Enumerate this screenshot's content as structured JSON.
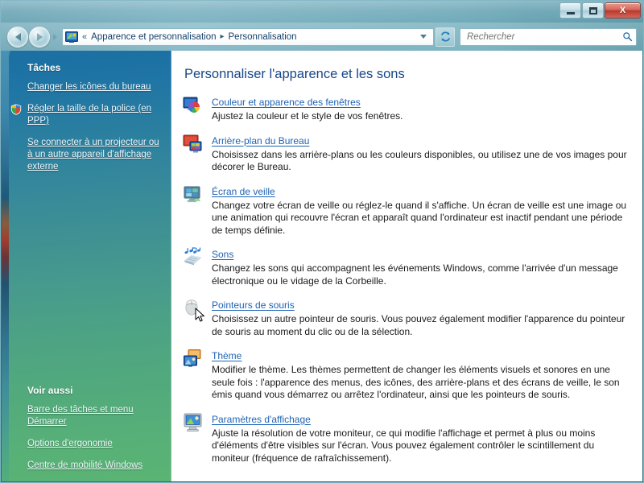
{
  "window": {
    "controls": {
      "minimize": "—",
      "maximize": "□",
      "close": "X"
    }
  },
  "toolbar": {
    "back_tooltip": "Précédent",
    "forward_tooltip": "Suivant",
    "breadcrumb_chevron": "«",
    "breadcrumb": [
      {
        "label": "Apparence et personnalisation"
      },
      {
        "label": "Personnalisation"
      }
    ],
    "breadcrumb_separator": "▸",
    "refresh_label": "↯",
    "search": {
      "placeholder": "Rechercher",
      "value": "",
      "icon": "search-icon"
    }
  },
  "sidebar": {
    "tasks_heading": "Tâches",
    "tasks": [
      {
        "label": "Changer les icônes du bureau",
        "shield": false
      },
      {
        "label": "Régler la taille de la police (en PPP)",
        "shield": true
      },
      {
        "label": "Se connecter à un projecteur ou à un autre appareil d'affichage externe",
        "shield": false
      }
    ],
    "see_also_heading": "Voir aussi",
    "see_also": [
      {
        "label": "Barre des tâches et menu Démarrer"
      },
      {
        "label": "Options d'ergonomie"
      },
      {
        "label": "Centre de mobilité Windows"
      }
    ]
  },
  "main": {
    "title": "Personnaliser l'apparence et les sons",
    "items": [
      {
        "icon": "window-color-icon",
        "link": "Couleur et apparence des fenêtres",
        "desc": "Ajustez la couleur et le style de vos fenêtres."
      },
      {
        "icon": "desktop-background-icon",
        "link": "Arrière-plan du Bureau",
        "desc": "Choisissez dans les arrière-plans ou les couleurs disponibles, ou utilisez une de vos images pour décorer le Bureau."
      },
      {
        "icon": "screensaver-icon",
        "link": "Écran de veille",
        "desc": "Changez votre écran de veille ou réglez-le quand il s'affiche. Un écran de veille est une image ou une animation qui recouvre l'écran et apparaît quand l'ordinateur est inactif pendant une période de temps définie."
      },
      {
        "icon": "sounds-icon",
        "link": "Sons",
        "desc": "Changez les sons qui accompagnent les événements Windows, comme l'arrivée d'un message électronique ou le vidage de la Corbeille."
      },
      {
        "icon": "mouse-pointers-icon",
        "link": "Pointeurs de souris",
        "desc": "Choisissez un autre pointeur de souris. Vous pouvez également modifier l'apparence du pointeur de souris au moment du clic ou de la sélection."
      },
      {
        "icon": "theme-icon",
        "link": "Thème",
        "desc": "Modifier le thème. Les thèmes permettent de changer les éléments visuels et sonores en une seule fois : l'apparence des menus, des icônes, des arrière-plans et des écrans de veille, le son émis quand vous démarrez ou arrêtez l'ordinateur, ainsi que les pointeurs de souris."
      },
      {
        "icon": "display-settings-icon",
        "link": "Paramètres d'affichage",
        "desc": "Ajuste la résolution de votre moniteur, ce qui modifie l'affichage et permet à plus ou moins d'éléments d'être visibles sur l'écran. Vous pouvez également contrôler le scintillement du moniteur (fréquence de rafraîchissement)."
      }
    ]
  },
  "colors": {
    "link": "#1f63b4",
    "title": "#17478a",
    "sidebar_top": "#1b6fa3",
    "sidebar_bottom": "#5ab473",
    "close_button": "#b8382c"
  }
}
